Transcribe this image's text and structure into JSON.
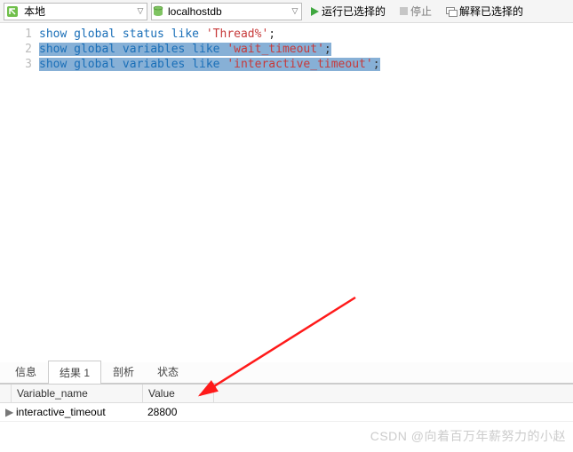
{
  "toolbar": {
    "connection": {
      "label": "本地"
    },
    "database": {
      "label": "localhostdb"
    },
    "run": "运行已选择的",
    "stop": "停止",
    "explain": "解释已选择的"
  },
  "editor": {
    "lines": [
      {
        "num": "1",
        "kw": "show global status like ",
        "str": "'Thread%'",
        "tail": ";"
      },
      {
        "num": "2",
        "kw": "show global variables like ",
        "str": "'wait_timeout'",
        "tail": ";"
      },
      {
        "num": "3",
        "kw": "show global variables like ",
        "str": "'interactive_timeout'",
        "tail": ";"
      }
    ]
  },
  "tabs": {
    "info": "信息",
    "result": "结果 1",
    "profile": "剖析",
    "status": "状态"
  },
  "grid": {
    "headers": {
      "name": "Variable_name",
      "value": "Value"
    },
    "rows": [
      {
        "name": "interactive_timeout",
        "value": "28800"
      }
    ]
  },
  "watermark": "CSDN @向着百万年薪努力的小赵"
}
